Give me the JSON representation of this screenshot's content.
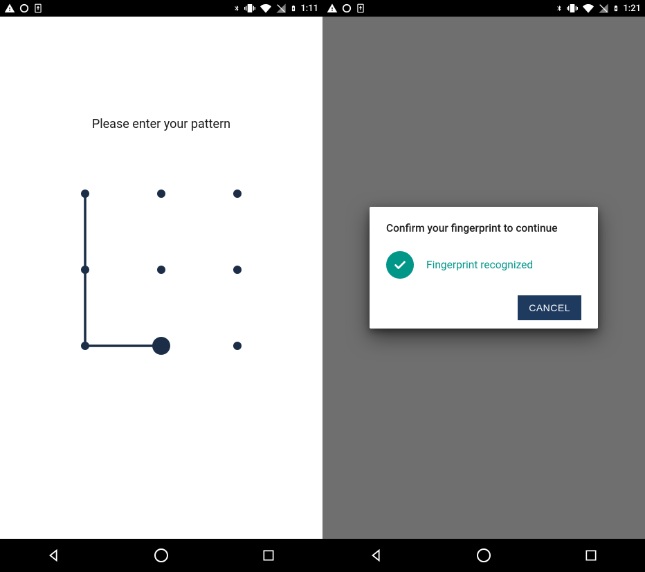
{
  "left": {
    "statusbar": {
      "time": "1:11"
    },
    "pattern": {
      "title": "Please enter your pattern",
      "path_dots": [
        0,
        3,
        6,
        7
      ],
      "active_dot": 7
    }
  },
  "right": {
    "statusbar": {
      "time": "1:21"
    },
    "dialog": {
      "title": "Confirm your fingerprint to continue",
      "status_text": "Fingerprint recognized",
      "cancel_label": "CANCEL"
    }
  },
  "colors": {
    "pattern_dot": "#1c2e47",
    "accent_teal": "#009688",
    "button_blue": "#1f3a5f"
  }
}
